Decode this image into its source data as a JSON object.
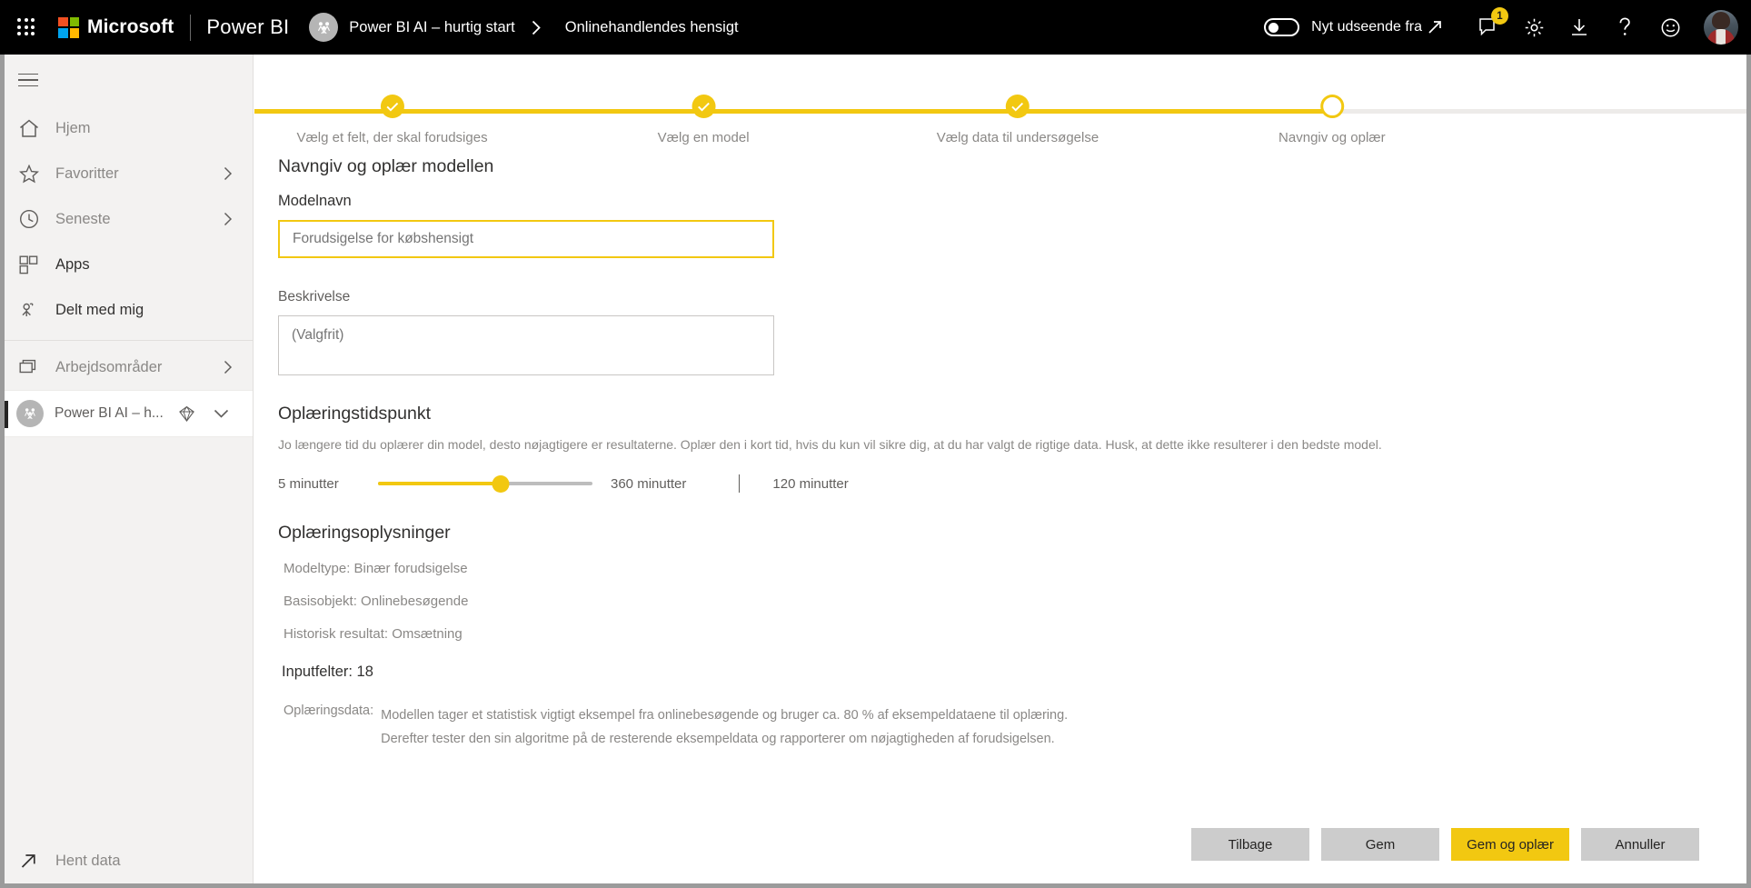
{
  "header": {
    "waffle_label": "App launcher",
    "microsoft_label": "Microsoft",
    "product_label": "Power BI",
    "breadcrumb": {
      "workspace": "Power BI AI – hurtig start",
      "item": "Onlinehandlendes hensigt"
    },
    "new_look_toggle_label": "Nyt udseende fra",
    "notification_badge": "1",
    "icons": {
      "waffle": "waffle-grid-icon",
      "group_avatar": "group-avatar-icon",
      "breadcrumb_separator": "chevron-right-icon",
      "new_look_arrow": "diagonal-arrow-icon",
      "notifications": "notification-bell-icon",
      "settings": "gear-icon",
      "download": "download-icon",
      "help": "question-mark-icon",
      "feedback": "smiley-icon",
      "account": "user-avatar"
    }
  },
  "sidebar": {
    "hamburger_label": "Navigationsrude",
    "items": [
      {
        "label": "Hjem",
        "icon": "home-icon",
        "chevron": false,
        "strong": false
      },
      {
        "label": "Favoritter",
        "icon": "star-icon",
        "chevron": true,
        "strong": false
      },
      {
        "label": "Seneste",
        "icon": "clock-icon",
        "chevron": true,
        "strong": false
      },
      {
        "label": "Apps",
        "icon": "apps-grid-icon",
        "chevron": false,
        "strong": true
      },
      {
        "label": "Delt med mig",
        "icon": "shared-person-icon",
        "chevron": false,
        "strong": true
      },
      {
        "label": "Arbejdsområder",
        "icon": "workspaces-stack-icon",
        "chevron": true,
        "strong": false
      }
    ],
    "workspace": {
      "label": "Power BI AI – h...",
      "avatar_icon": "group-avatar-icon",
      "premium_icon": "diamond-icon",
      "chevron_icon": "chevron-down-icon"
    },
    "get_data": {
      "label": "Hent data",
      "icon": "arrow-up-right-icon"
    }
  },
  "stepper": {
    "steps": [
      {
        "label": "Vælg et felt, der skal forudsiges",
        "state": "done",
        "x_pct": 9.2
      },
      {
        "label": "Vælg en model",
        "state": "done",
        "x_pct": 30.0
      },
      {
        "label": "Vælg data til undersøgelse",
        "state": "done",
        "x_pct": 51.0
      },
      {
        "label": "Navngiv og oplær",
        "state": "current",
        "x_pct": 72.0
      }
    ],
    "progress_pct": 72.0
  },
  "form": {
    "section_title": "Navngiv og oplær modellen",
    "model_name": {
      "label": "Modelnavn",
      "value": "",
      "placeholder": "Forudsigelse for købshensigt"
    },
    "description": {
      "label": "Beskrivelse",
      "value": "",
      "placeholder": "(Valgfrit)"
    },
    "training_time": {
      "title": "Oplæringstidspunkt",
      "help": "Jo længere tid du oplærer din model, desto nøjagtigere er resultaterne. Oplær den i kort tid, hvis du kun vil sikre dig, at du har valgt de rigtige data. Husk, at dette ikke resulterer i den bedste model.",
      "min_label": "5 minutter",
      "max_label": "360 minutter",
      "current_label": "120 minutter",
      "min": 5,
      "max": 360,
      "value": 120,
      "fill_pct": 57
    },
    "training_details": {
      "title": "Oplæringsoplysninger",
      "rows": [
        "Modeltype: Binær forudsigelse",
        "Basisobjekt: Onlinebesøgende",
        "Historisk resultat: Omsætning"
      ],
      "input_fields": "Inputfelter: 18",
      "training_data_key": "Oplæringsdata:",
      "training_data_text": "Modellen tager et statistisk vigtigt eksempel fra onlinebesøgende og bruger ca. 80 % af eksempeldataene til oplæring. Derefter tester den sin algoritme på de resterende eksempeldata og rapporterer om nøjagtigheden af forudsigelsen."
    }
  },
  "footer": {
    "back_label": "Tilbage",
    "save_label": "Gem",
    "save_train_label": "Gem og oplær",
    "cancel_label": "Annuller"
  },
  "colors": {
    "brand_yellow": "#F2C811",
    "header_black": "#000000",
    "nav_background": "#F3F2F1",
    "button_gray": "#CCCCCC",
    "text_muted": "#8A8886",
    "text_dark": "#323130"
  }
}
